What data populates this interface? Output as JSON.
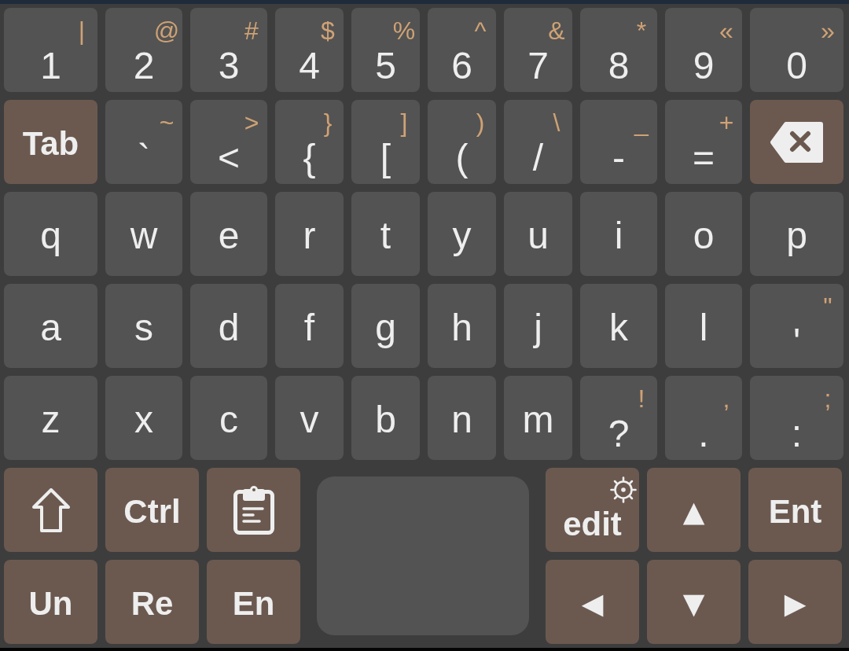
{
  "main_rows": [
    [
      {
        "kind": "char",
        "label": "1",
        "shift_label": "|"
      },
      {
        "kind": "char",
        "label": "2",
        "shift_label": "@"
      },
      {
        "kind": "char",
        "label": "3",
        "shift_label": "#"
      },
      {
        "kind": "char",
        "label": "4",
        "shift_label": "$"
      },
      {
        "kind": "char",
        "label": "5",
        "shift_label": "%"
      },
      {
        "kind": "char",
        "label": "6",
        "shift_label": "^"
      },
      {
        "kind": "char",
        "label": "7",
        "shift_label": "&"
      },
      {
        "kind": "char",
        "label": "8",
        "shift_label": "*"
      },
      {
        "kind": "char",
        "label": "9",
        "shift_label": "«"
      },
      {
        "kind": "char",
        "label": "0",
        "shift_label": "»"
      }
    ],
    [
      {
        "kind": "action",
        "label": "Tab"
      },
      {
        "kind": "char",
        "label": "`",
        "shift_label": "~"
      },
      {
        "kind": "char",
        "label": "<",
        "shift_label": ">"
      },
      {
        "kind": "char",
        "label": "{",
        "shift_label": "}"
      },
      {
        "kind": "char",
        "label": "[",
        "shift_label": "]"
      },
      {
        "kind": "char",
        "label": "(",
        "shift_label": ")"
      },
      {
        "kind": "char",
        "label": "/",
        "shift_label": "\\"
      },
      {
        "kind": "char",
        "label": "-",
        "shift_label": "_"
      },
      {
        "kind": "char",
        "label": "=",
        "shift_label": "+"
      },
      {
        "kind": "backspace"
      }
    ],
    [
      {
        "kind": "char",
        "label": "q"
      },
      {
        "kind": "char",
        "label": "w"
      },
      {
        "kind": "char",
        "label": "e"
      },
      {
        "kind": "char",
        "label": "r"
      },
      {
        "kind": "char",
        "label": "t"
      },
      {
        "kind": "char",
        "label": "y"
      },
      {
        "kind": "char",
        "label": "u"
      },
      {
        "kind": "char",
        "label": "i"
      },
      {
        "kind": "char",
        "label": "o"
      },
      {
        "kind": "char",
        "label": "p"
      }
    ],
    [
      {
        "kind": "char",
        "label": "a"
      },
      {
        "kind": "char",
        "label": "s"
      },
      {
        "kind": "char",
        "label": "d"
      },
      {
        "kind": "char",
        "label": "f"
      },
      {
        "kind": "char",
        "label": "g"
      },
      {
        "kind": "char",
        "label": "h"
      },
      {
        "kind": "char",
        "label": "j"
      },
      {
        "kind": "char",
        "label": "k"
      },
      {
        "kind": "char",
        "label": "l"
      },
      {
        "kind": "char",
        "label": "'",
        "shift_label": "\""
      }
    ],
    [
      {
        "kind": "char",
        "label": "z"
      },
      {
        "kind": "char",
        "label": "x"
      },
      {
        "kind": "char",
        "label": "c"
      },
      {
        "kind": "char",
        "label": "v"
      },
      {
        "kind": "char",
        "label": "b"
      },
      {
        "kind": "char",
        "label": "n"
      },
      {
        "kind": "char",
        "label": "m"
      },
      {
        "kind": "char",
        "label": "?",
        "shift_label": "!"
      },
      {
        "kind": "char",
        "label": ".",
        "shift_label": ","
      },
      {
        "kind": "char",
        "label": ":",
        "shift_label": ";"
      }
    ]
  ],
  "bottom_left_rows": [
    [
      {
        "kind": "shift"
      },
      {
        "kind": "action",
        "label": "Ctrl"
      },
      {
        "kind": "clipboard"
      }
    ],
    [
      {
        "kind": "action",
        "label": "Un"
      },
      {
        "kind": "action",
        "label": "Re"
      },
      {
        "kind": "action",
        "label": "En"
      }
    ]
  ],
  "bottom_right_rows": [
    [
      {
        "kind": "gear",
        "label": "edit"
      },
      {
        "kind": "arrow",
        "label": "▲"
      },
      {
        "kind": "action",
        "label": "Ent"
      }
    ],
    [
      {
        "kind": "arrow",
        "label": "◀"
      },
      {
        "kind": "arrow",
        "label": "▼"
      },
      {
        "kind": "arrow",
        "label": "▶"
      }
    ]
  ]
}
